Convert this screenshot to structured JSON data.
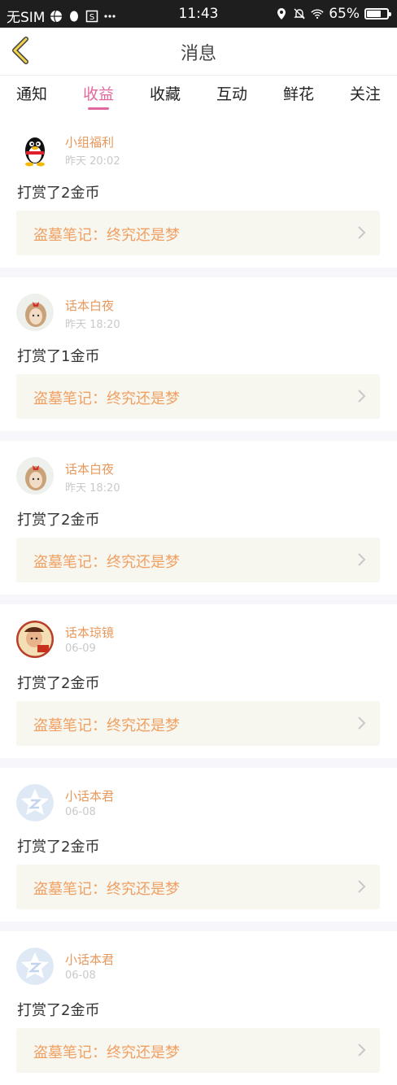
{
  "status": {
    "carrier": "无SIM",
    "time": "11:43",
    "battery": "65%",
    "icons": [
      "basketball-icon",
      "qq-icon",
      "s-box-icon",
      "more-dots-icon",
      "location-icon",
      "mute-bell-icon",
      "wifi-icon",
      "battery-icon"
    ]
  },
  "header": {
    "title": "消息",
    "back_icon": "back-chevron-icon"
  },
  "tabs": [
    {
      "label": "通知",
      "active": false
    },
    {
      "label": "收益",
      "active": true
    },
    {
      "label": "收藏",
      "active": false
    },
    {
      "label": "互动",
      "active": false
    },
    {
      "label": "鲜花",
      "active": false
    },
    {
      "label": "关注",
      "active": false
    }
  ],
  "feed": [
    {
      "name": "小组福利",
      "time": "昨天 20:02",
      "message": "打赏了2金币",
      "link": "盗墓笔记：终究还是梦",
      "avatar": "qq-penguin-avatar"
    },
    {
      "name": "话本白夜",
      "time": "昨天 18:20",
      "message": "打赏了1金币",
      "link": "盗墓笔记：终究还是梦",
      "avatar": "doll-avatar"
    },
    {
      "name": "话本白夜",
      "time": "昨天 18:20",
      "message": "打赏了2金币",
      "link": "盗墓笔记：终究还是梦",
      "avatar": "doll-avatar"
    },
    {
      "name": "话本琼镜",
      "time": "06-09",
      "message": "打赏了2金币",
      "link": "盗墓笔记：终究还是梦",
      "avatar": "cartoon-avatar"
    },
    {
      "name": "小话本君",
      "time": "06-08",
      "message": "打赏了2金币",
      "link": "盗墓笔记：终究还是梦",
      "avatar": "star-z-avatar"
    },
    {
      "name": "小话本君",
      "time": "06-08",
      "message": "打赏了2金币",
      "link": "盗墓笔记：终究还是梦",
      "avatar": "star-z-avatar"
    }
  ],
  "colors": {
    "accent_pink": "#e3679e",
    "name_orange": "#e7985b",
    "link_orange": "#f0a062",
    "link_bg": "#f7f6ef"
  }
}
